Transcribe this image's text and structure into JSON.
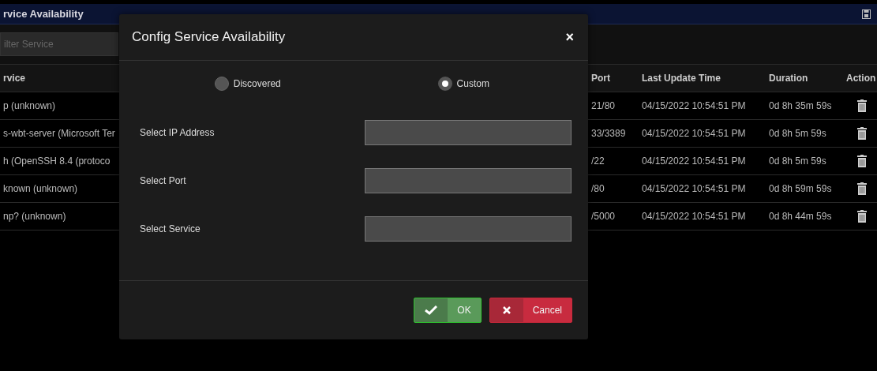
{
  "page": {
    "title": "rvice Availability",
    "filter": {
      "placeholder": "ilter Service"
    }
  },
  "table": {
    "columns": [
      "rvice",
      "Port",
      "Last Update Time",
      "Duration",
      "Action"
    ],
    "rows": [
      {
        "service": "p (unknown)",
        "port": "21/80",
        "time": "04/15/2022 10:54:51 PM",
        "duration": "0d 8h 35m 59s"
      },
      {
        "service": "s-wbt-server (Microsoft Ter",
        "port": "33/3389",
        "time": "04/15/2022 10:54:51 PM",
        "duration": "0d 8h 5m 59s"
      },
      {
        "service": "h (OpenSSH 8.4 (protoco",
        "port": "/22",
        "time": "04/15/2022 10:54:51 PM",
        "duration": "0d 8h 5m 59s"
      },
      {
        "service": "known (unknown)",
        "port": "/80",
        "time": "04/15/2022 10:54:51 PM",
        "duration": "0d 8h 59m 59s"
      },
      {
        "service": "np? (unknown)",
        "port": "/5000",
        "time": "04/15/2022 10:54:51 PM",
        "duration": "0d 8h 44m 59s"
      }
    ]
  },
  "dialog": {
    "title": "Config Service Availability",
    "close": "×",
    "modes": [
      {
        "label": "Discovered",
        "selected": false
      },
      {
        "label": "Custom",
        "selected": true
      }
    ],
    "fields": [
      {
        "label": "Select IP Address"
      },
      {
        "label": "Select Port"
      },
      {
        "label": "Select Service"
      }
    ],
    "buttons": [
      {
        "kind": "ok",
        "label": "OK"
      },
      {
        "kind": "cancel",
        "label": "Cancel"
      }
    ]
  }
}
